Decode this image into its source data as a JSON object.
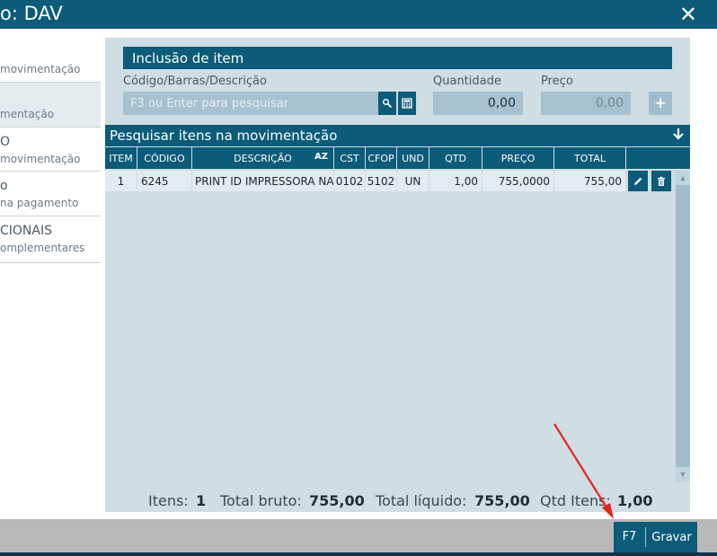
{
  "window": {
    "title": "o: DAV"
  },
  "nav": {
    "items": [
      {
        "line1": "",
        "line2": "movimentação"
      },
      {
        "line1": "",
        "line2": "mentação"
      },
      {
        "line1": "O",
        "line2": "movimentação"
      },
      {
        "line1": "o",
        "line2": "na pagamento"
      },
      {
        "line1": "CIONAIS",
        "line2": "omplementares"
      }
    ]
  },
  "inclusao": {
    "header": "Inclusão de item",
    "codigo_label": "Código/Barras/Descrição",
    "search_placeholder": "F3 ou Enter para pesquisar",
    "quantidade_label": "Quantidade",
    "quantidade_value": "0,00",
    "preco_label": "Preço",
    "preco_value": "0,00"
  },
  "grid": {
    "title": "Pesquisar itens na movimentação",
    "sort_badge": "AZ",
    "columns": [
      "ITEM",
      "CÓDIGO",
      "DESCRIÇÃO",
      "CST",
      "CFOP",
      "UND",
      "QTD",
      "PREÇO",
      "TOTAL"
    ],
    "rows": [
      {
        "item": "1",
        "codigo": "6245",
        "descricao": "PRINT ID IMPRESSORA NAO",
        "cst": "0102",
        "cfop": "5102",
        "und": "UN",
        "qtd": "1,00",
        "preco": "755,0000",
        "total": "755,00"
      }
    ]
  },
  "totals": {
    "itens_label": "Itens:",
    "itens_value": "1",
    "bruto_label": "Total bruto:",
    "bruto_value": "755,00",
    "liquido_label": "Total líquido:",
    "liquido_value": "755,00",
    "qtd_label": "Qtd Itens:",
    "qtd_value": "1,00"
  },
  "footer": {
    "save_key": "F7",
    "save_label": "Gravar"
  },
  "colors": {
    "primary": "#0b5b79",
    "panel": "#cfdde4",
    "input": "#a7c1ce",
    "arrow": "#e8231d"
  },
  "icons": {
    "close": "close-icon",
    "search": "search-icon",
    "calculator": "calculator-icon",
    "plus": "plus-icon",
    "collapse": "arrow-down-icon",
    "edit": "pencil-icon",
    "delete": "trash-icon"
  }
}
